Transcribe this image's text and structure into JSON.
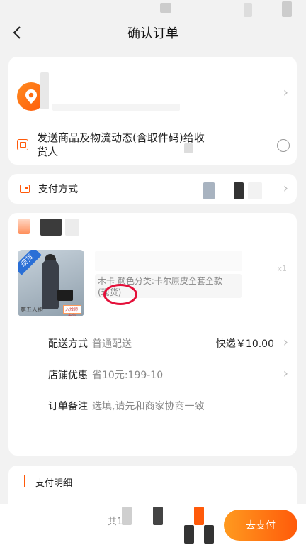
{
  "nav": {
    "title": "确认订单"
  },
  "notify": {
    "text": "发送商品及物流动态(含取件码)给收货人"
  },
  "payment": {
    "label": "支付方式"
  },
  "product": {
    "sku_line1": "木卡 颜色分类:卡尔原皮全套全款",
    "sku_line2": "(现货)",
    "img_caption": "第五人格",
    "img_tag": "入殓师·卡尔",
    "stock_tag": "现货",
    "qty": "x1"
  },
  "details": {
    "shipping": {
      "label": "配送方式",
      "value": "普通配送",
      "right": "快递￥10.00"
    },
    "coupon": {
      "label": "店铺优惠",
      "value": "省10元:199-10"
    },
    "note": {
      "label": "订单备注",
      "value": "选填,请先和商家协商一致"
    }
  },
  "summary": {
    "title": "支付明细"
  },
  "bottom": {
    "total_prefix": "共1",
    "pay_button": "去支付"
  }
}
